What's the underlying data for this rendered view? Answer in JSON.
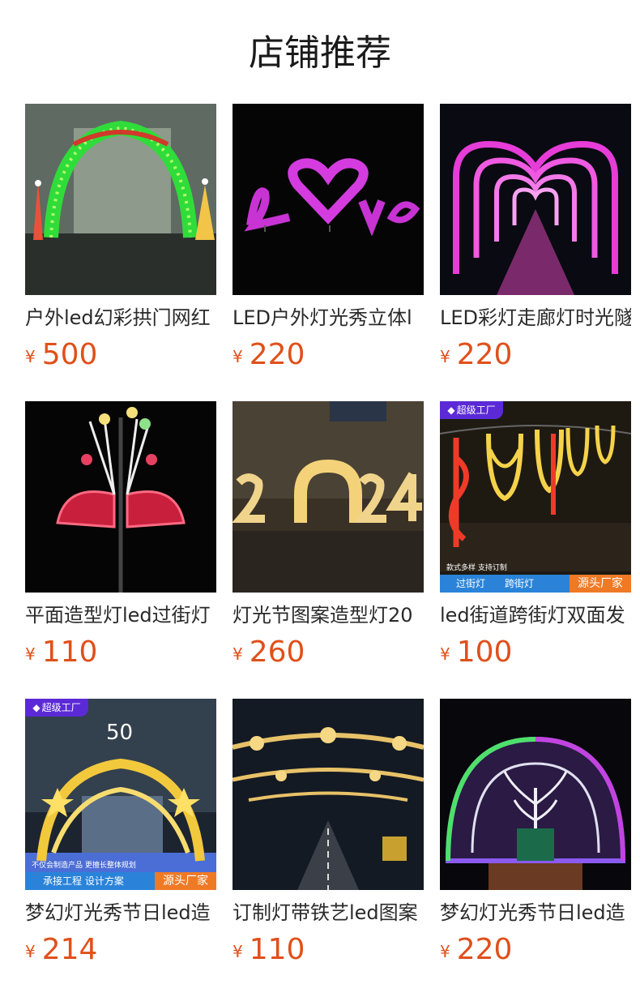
{
  "section_title": "店铺推荐",
  "currency_symbol": "¥",
  "badge_label": "超级工厂",
  "products": [
    {
      "name": "户外led幻彩拱门网红",
      "price": "500",
      "image": "green-christmas-arch"
    },
    {
      "name": "LED户外灯光秀立体l",
      "price": "220",
      "image": "love-letters-sculpture"
    },
    {
      "name": "LED彩灯走廊灯时光隧",
      "price": "220",
      "image": "heart-tunnel-corridor"
    },
    {
      "name": "平面造型灯led过街灯",
      "price": "110",
      "image": "pole-fan-star-motif"
    },
    {
      "name": "灯光节图案造型灯20",
      "price": "260",
      "image": "2024-number-sculpture"
    },
    {
      "name": "led街道跨街灯双面发",
      "price": "100",
      "image": "street-cross-lights",
      "overlay": {
        "line1": "款式多样 支持订制",
        "tag1": "过街灯",
        "tag2": "跨街灯",
        "tag3": "源头厂家"
      }
    },
    {
      "name": "梦幻灯光秀节日led造",
      "price": "214",
      "image": "golden-ribbon-arch",
      "overlay": {
        "line1": "不仅会制造产品 更擅长整体规划",
        "tag1": "承接工程 设计方案",
        "tag3": "源头厂家"
      }
    },
    {
      "name": "订制灯带铁艺led图案",
      "price": "110",
      "image": "street-snowflake-garlands"
    },
    {
      "name": "梦幻灯光秀节日led造",
      "price": "220",
      "image": "dome-tree-tunnel"
    }
  ]
}
